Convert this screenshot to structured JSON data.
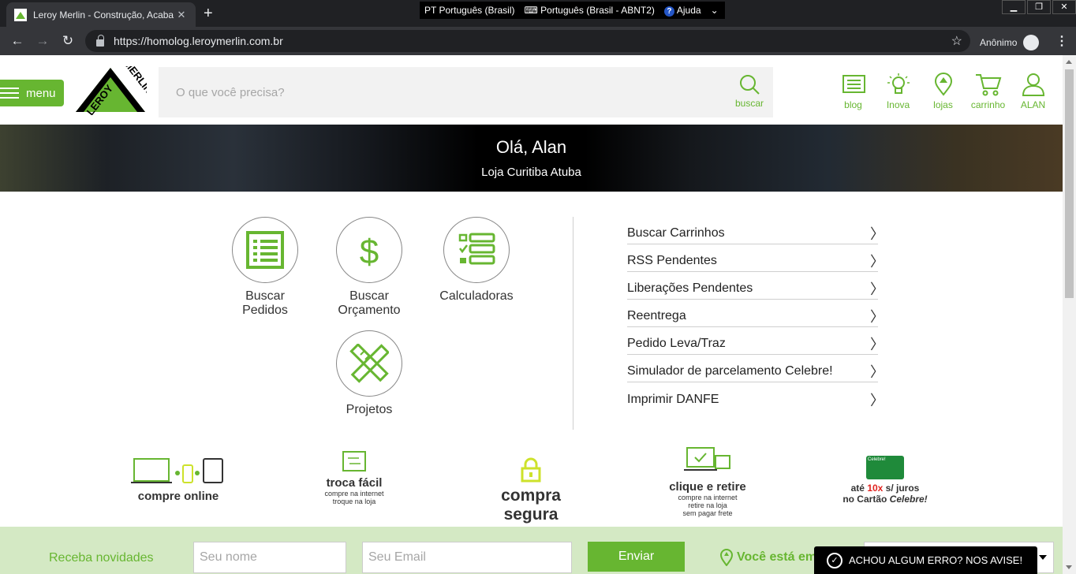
{
  "browser": {
    "tab_title": "Leroy Merlin - Construção, Acaba",
    "tab_close": "✕",
    "new_tab": "+",
    "lang_items": [
      "PT Português (Brasil)",
      "⌨ Português (Brasil - ABNT2)",
      "Ajuda"
    ],
    "lang_help_icon": "?",
    "lang_arrow": "⌄",
    "url": "https://homolog.leroymerlin.com.br",
    "incognito_label": "Anônimo",
    "back": "←",
    "forward": "→",
    "reload": "↻",
    "star": "☆",
    "menu": "⋮",
    "win_minimize": "▁",
    "win_restore": "❐",
    "win_close": "✕"
  },
  "header": {
    "menu_label": "menu",
    "search_placeholder": "O que você precisa?",
    "search_button": "buscar",
    "icons": [
      {
        "label": "blog",
        "icon": "blog-icon"
      },
      {
        "label": "Inova",
        "icon": "lightbulb-icon"
      },
      {
        "label": "lojas",
        "icon": "location-pin-icon"
      },
      {
        "label": "carrinho",
        "icon": "cart-icon"
      },
      {
        "label": "ALAN",
        "icon": "user-icon"
      }
    ]
  },
  "banner": {
    "greeting": "Olá, Alan",
    "store": "Loja Curitiba Atuba"
  },
  "quick_actions": [
    {
      "line1": "Buscar",
      "line2": "Pedidos",
      "icon": "list-icon"
    },
    {
      "line1": "Buscar",
      "line2": "Orçamento",
      "icon": "dollar-icon"
    },
    {
      "line1": "Calculadoras",
      "line2": "",
      "icon": "checklist-icon"
    },
    {
      "line1": "Projetos",
      "line2": "",
      "icon": "ruler-pencil-icon"
    }
  ],
  "links": [
    "Buscar Carrinhos",
    "RSS Pendentes",
    "Liberações Pendentes",
    "Reentrega",
    "Pedido Leva/Traz",
    "Simulador de parcelamento Celebre!",
    "Imprimir DANFE"
  ],
  "benefits": {
    "online": "compre online",
    "troca_title": "troca fácil",
    "troca_sub1": "compre na internet",
    "troca_sub2": "troque na loja",
    "segura": "compra segura",
    "clique_title": "clique e retire",
    "clique_sub1": "compre na internet",
    "clique_sub2": "retire na loja",
    "clique_sub3": "sem pagar frete",
    "card_brand": "Celebre!",
    "card_line1_pre": "até ",
    "card_line1_highlight": "10x",
    "card_line1_post": " s/ juros",
    "card_line2_pre": "no Cartão ",
    "card_line2_em": "Celebre!"
  },
  "newsletter": {
    "label": "Receba novidades",
    "name_placeholder": "Seu nome",
    "email_placeholder": "Seu Email",
    "send": "Enviar",
    "location_text": "Você está em"
  },
  "report": {
    "label": "ACHOU ALGUM ERRO? NOS AVISE!"
  },
  "colors": {
    "brand_green": "#67b631",
    "newsletter_bg": "#d4e9c4"
  }
}
